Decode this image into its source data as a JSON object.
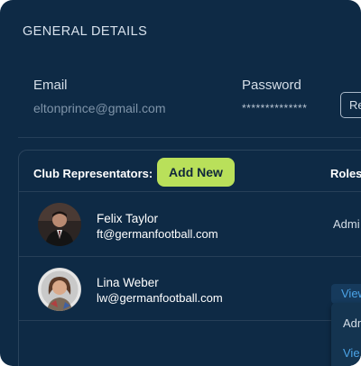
{
  "general": {
    "title": "GENERAL DETAILS",
    "email_label": "Email",
    "email_value": "eltonprince@gmail.com",
    "password_label": "Password",
    "password_value": "**************",
    "reset_button": "Re"
  },
  "representatives": {
    "title": "Club Representators:",
    "add_button": "Add New",
    "roles_header": "Roles",
    "rows": [
      {
        "name": "Felix Taylor",
        "email": "ft@germanfootball.com",
        "role": "Admi"
      },
      {
        "name": "Lina Weber",
        "email": "lw@germanfootball.com",
        "role": "View"
      }
    ],
    "dropdown": [
      "Adm",
      "Vie"
    ]
  },
  "colors": {
    "panel_bg": "#0e2a45",
    "accent_green": "#b9e05a",
    "link_blue": "#4ba3e6"
  }
}
